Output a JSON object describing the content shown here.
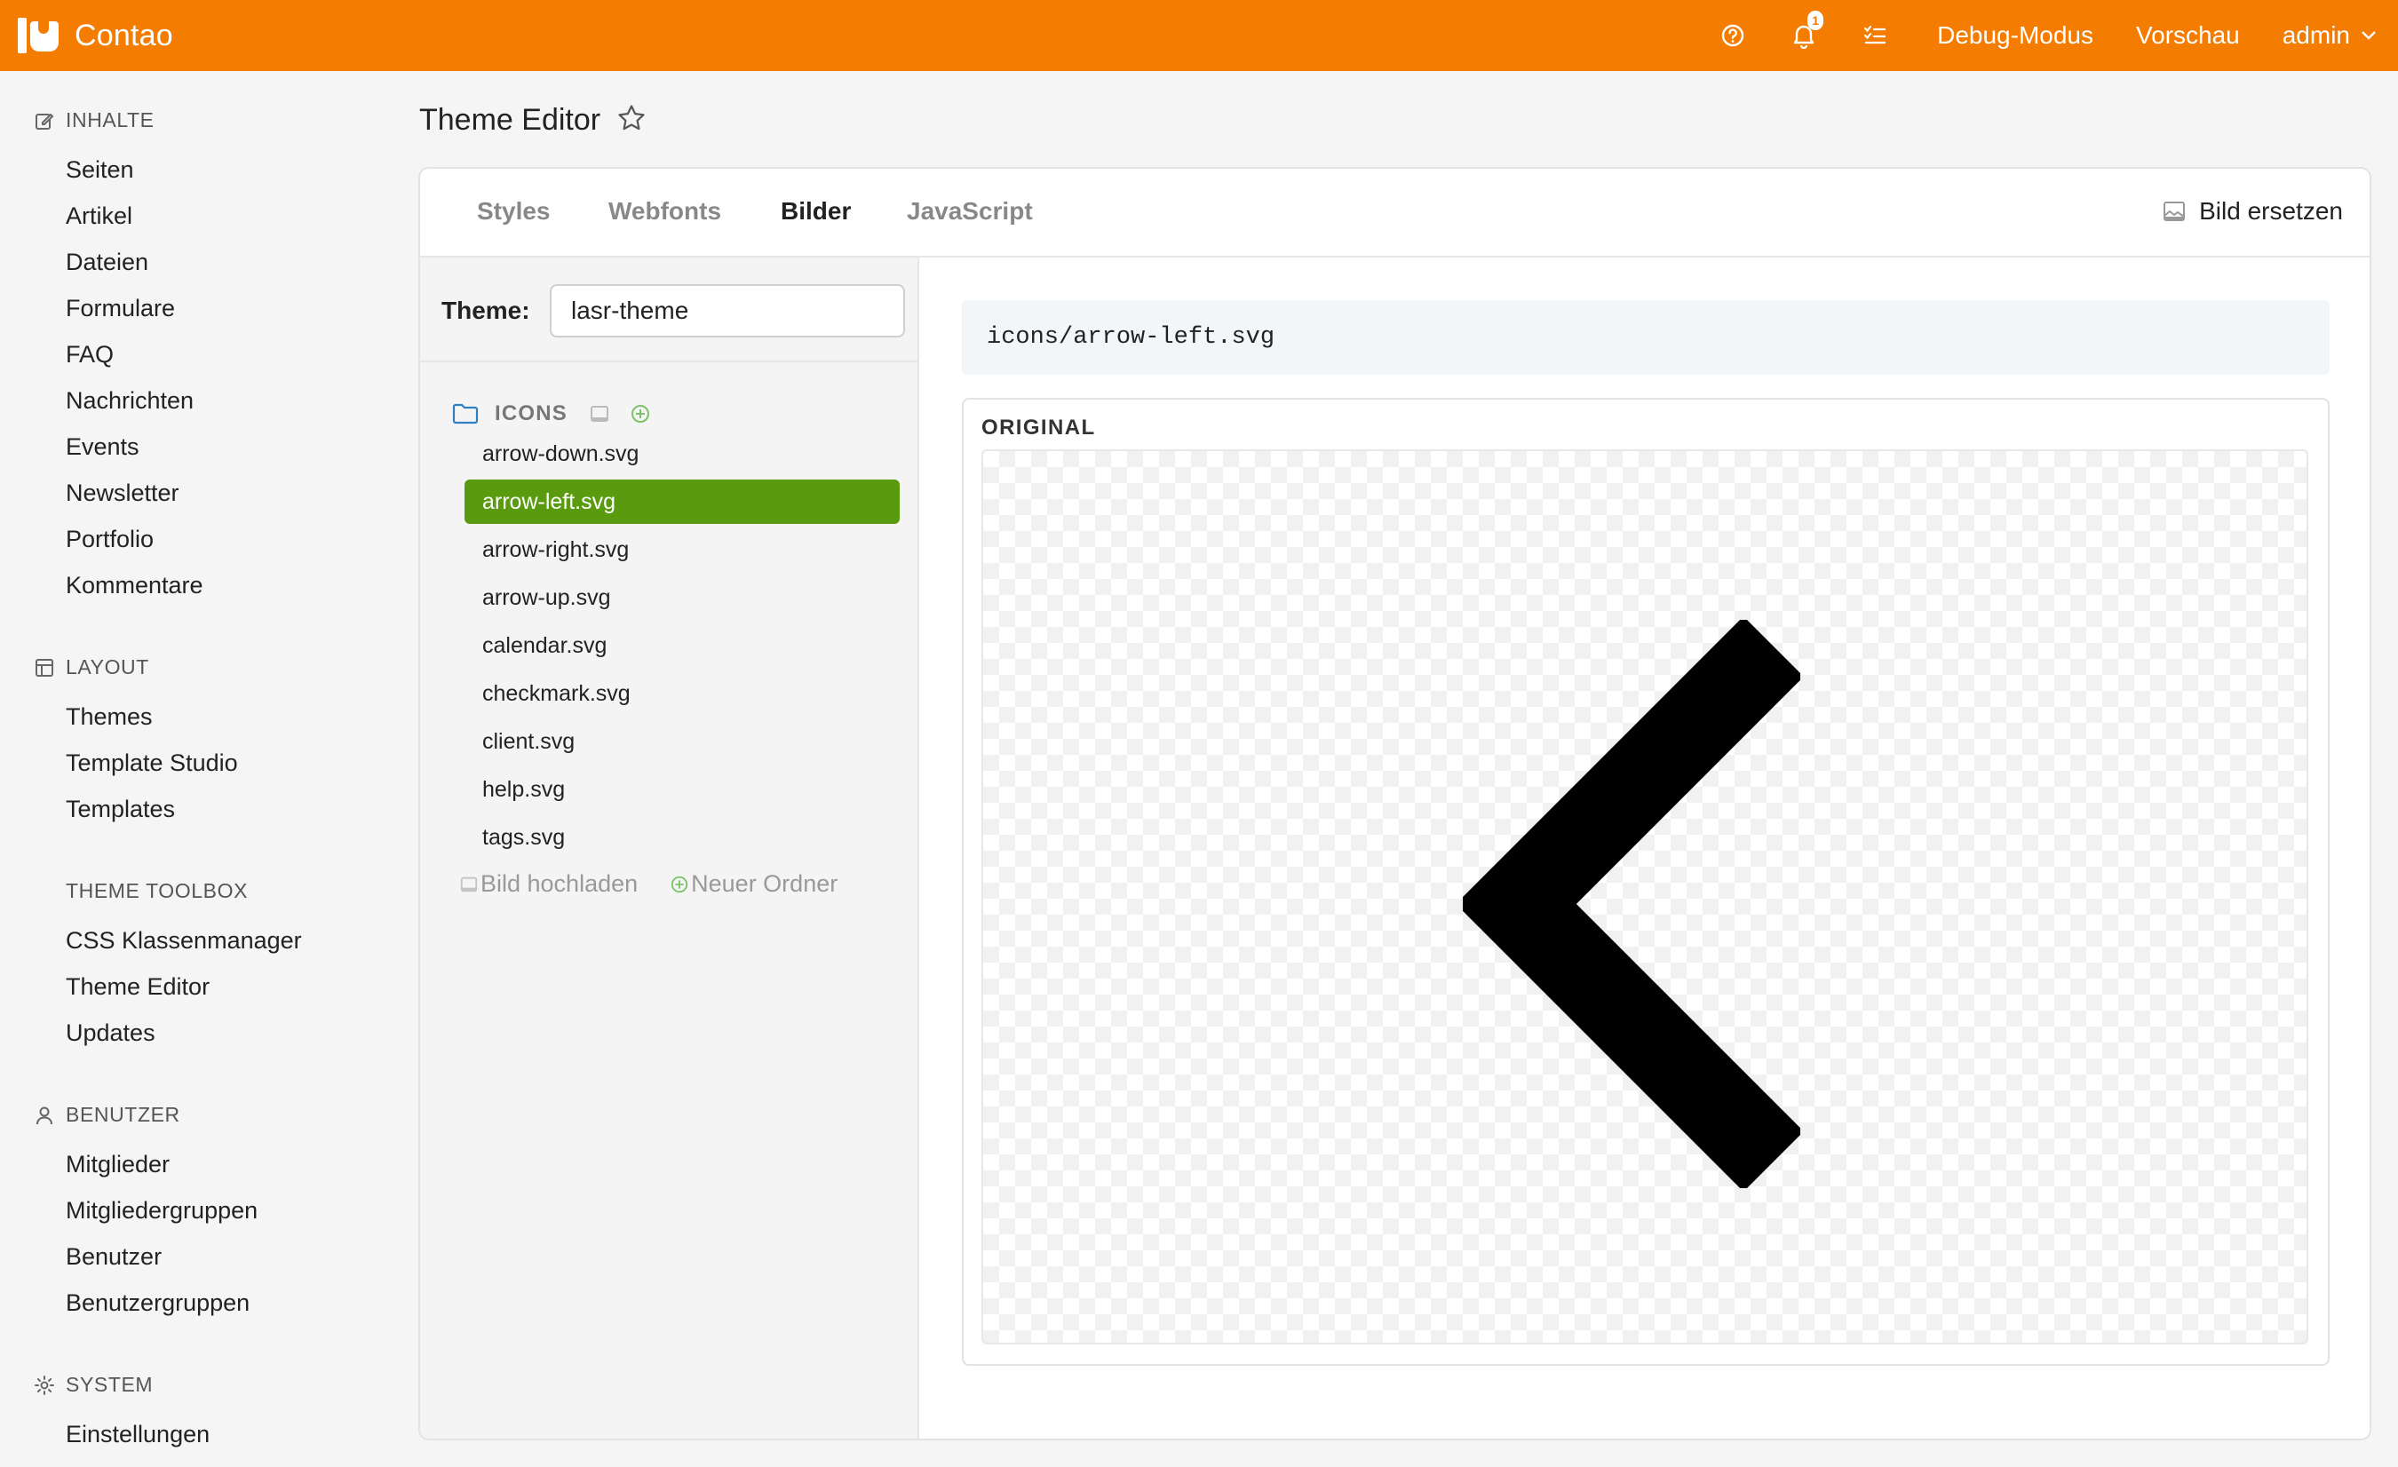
{
  "app": {
    "brand": "Contao",
    "accent_color": "#f47c00",
    "notification_count": "1",
    "top_links": {
      "debug": "Debug-Modus",
      "preview": "Vorschau",
      "user": "admin"
    }
  },
  "sidebar": {
    "sections": [
      {
        "title": "INHALTE",
        "icon": "edit-icon",
        "items": [
          "Seiten",
          "Artikel",
          "Dateien",
          "Formulare",
          "FAQ",
          "Nachrichten",
          "Events",
          "Newsletter",
          "Portfolio",
          "Kommentare"
        ]
      },
      {
        "title": "LAYOUT",
        "icon": "layout-icon",
        "items": [
          "Themes",
          "Template Studio",
          "Templates"
        ]
      },
      {
        "title": "THEME TOOLBOX",
        "icon": "",
        "items": [
          "CSS Klassenmanager",
          "Theme Editor",
          "Updates"
        ]
      },
      {
        "title": "BENUTZER",
        "icon": "user-icon",
        "items": [
          "Mitglieder",
          "Mitgliedergruppen",
          "Benutzer",
          "Benutzergruppen"
        ]
      },
      {
        "title": "SYSTEM",
        "icon": "gear-icon",
        "items": [
          "Einstellungen"
        ]
      }
    ]
  },
  "page": {
    "title": "Theme Editor"
  },
  "tabs": [
    {
      "label": "Styles",
      "active": false
    },
    {
      "label": "Webfonts",
      "active": false
    },
    {
      "label": "Bilder",
      "active": true
    },
    {
      "label": "JavaScript",
      "active": false
    }
  ],
  "replace_button": "Bild ersetzen",
  "theme": {
    "label": "Theme:",
    "value": "lasr-theme"
  },
  "folder": {
    "name": "ICONS"
  },
  "files": [
    "arrow-down.svg",
    "arrow-left.svg",
    "arrow-right.svg",
    "arrow-up.svg",
    "calendar.svg",
    "checkmark.svg",
    "client.svg",
    "help.svg",
    "tags.svg"
  ],
  "selected_file": "arrow-left.svg",
  "actions": {
    "upload": "Bild hochladen",
    "new_folder": "Neuer Ordner"
  },
  "preview": {
    "path": "icons/arrow-left.svg",
    "label": "ORIGINAL"
  },
  "colors": {
    "selected": "#5a9a0f",
    "folder_icon": "#2f7fc1",
    "add_icon": "#7bc26a"
  }
}
